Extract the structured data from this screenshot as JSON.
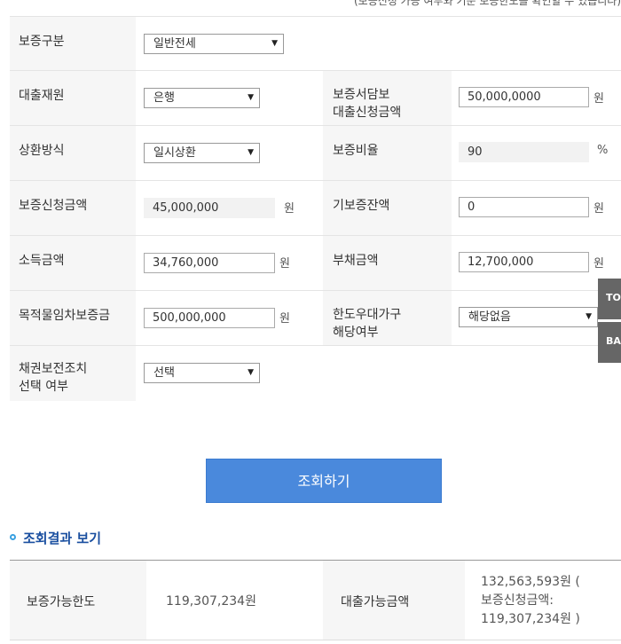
{
  "top_note": "(보증신청 가능 여부와 기준 보증한도를 확인할 수 있습니다)",
  "form": {
    "guarantee_type": {
      "label": "보증구분",
      "value": "일반전세"
    },
    "loan_source": {
      "label": "대출재원",
      "value": "은행"
    },
    "guarantee_loan_request": {
      "label_line1": "보증서담보",
      "label_line2": "대출신청금액",
      "value": "50,000,0000",
      "unit": "원"
    },
    "repayment_method": {
      "label": "상환방식",
      "value": "일시상환"
    },
    "guarantee_ratio": {
      "label": "보증비율",
      "value": "90",
      "unit": "%"
    },
    "guarantee_request_amount": {
      "label": "보증신청금액",
      "value": "45,000,000",
      "unit": "원"
    },
    "existing_guarantee_balance": {
      "label": "기보증잔액",
      "value": "0",
      "unit": "원"
    },
    "income_amount": {
      "label": "소득금액",
      "value": "34,760,000",
      "unit": "원"
    },
    "debt_amount": {
      "label": "부채금액",
      "value": "12,700,000",
      "unit": "원"
    },
    "lease_deposit": {
      "label": "목적물임차보증금",
      "value": "500,000,000",
      "unit": "원"
    },
    "preferred_household": {
      "label_line1": "한도우대가구",
      "label_line2": "해당여부",
      "value": "해당없음"
    },
    "bond_protection": {
      "label_line1": "채권보전조치",
      "label_line2": "선택 여부",
      "value": "선택"
    }
  },
  "submit_label": "조회하기",
  "result": {
    "section_title": "조회결과 보기",
    "limit_label": "보증가능한도",
    "limit_value": "119,307,234원",
    "loan_label": "대출가능금액",
    "loan_line1": "132,563,593원 (",
    "loan_line2": "보증신청금액:",
    "loan_line3": "119,307,234원 )"
  },
  "side": {
    "top_label": "TOP",
    "back_label": "BACK"
  }
}
